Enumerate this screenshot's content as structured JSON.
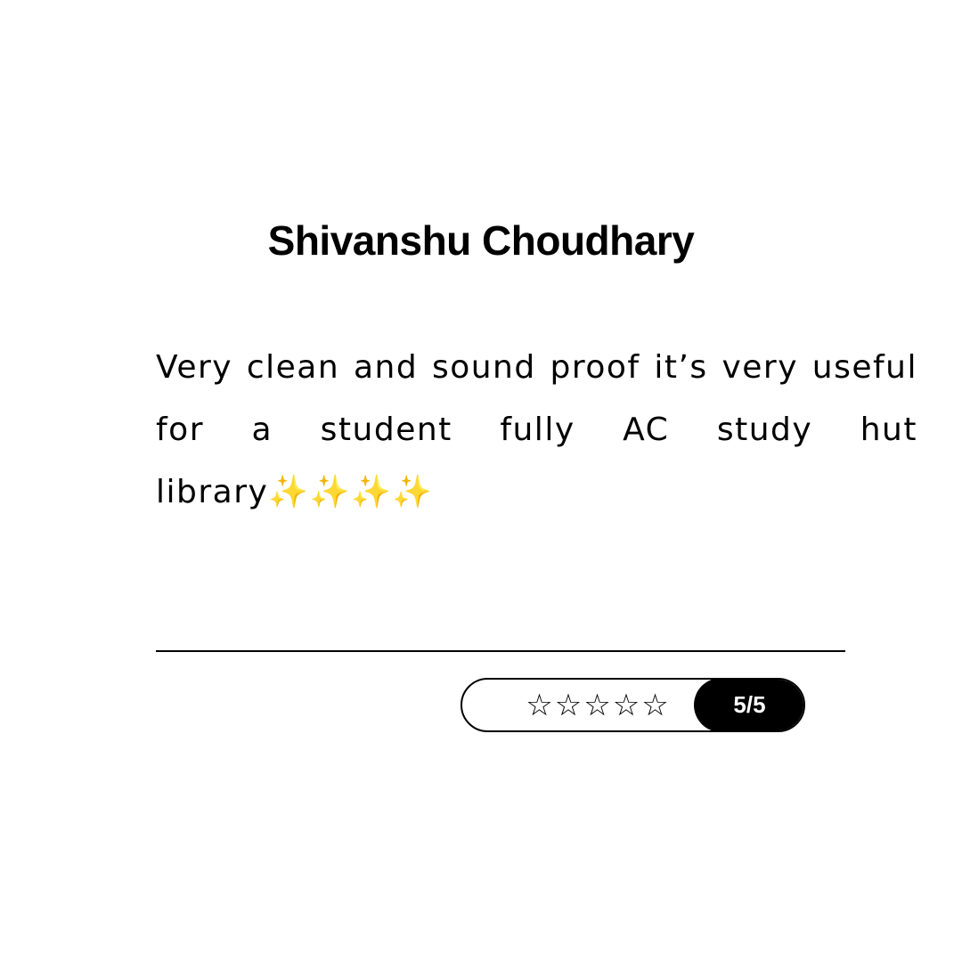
{
  "review": {
    "reviewer_name": "Shivanshu Choudhary",
    "text": "Very clean and sound proof it’s very useful for a student fully AC study hut library✨✨✨✨",
    "rating": {
      "value": 5,
      "max": 5,
      "stars_icon": "star-icon",
      "stars_display": "☆☆☆☆☆",
      "label": "5/5"
    }
  }
}
